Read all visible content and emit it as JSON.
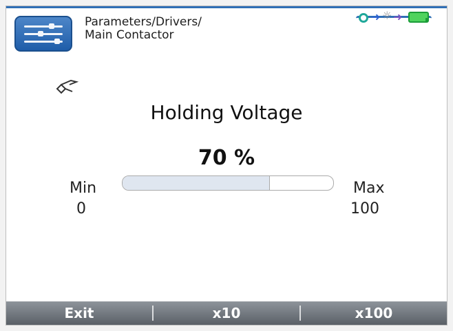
{
  "header": {
    "breadcrumb_line1": "Parameters/Drivers/",
    "breadcrumb_line2": "Main Contactor",
    "icon": "settings-sliders-icon"
  },
  "status": {
    "icons": [
      "connection-ring-icon",
      "arrow-right-icon",
      "bulb-icon",
      "arrow-right-icon",
      "battery-icon"
    ],
    "colors": {
      "ring": "#20a89a",
      "arrow1": "#2f63d1",
      "arrow2": "#7a55c2",
      "battery": "#4fd35d"
    }
  },
  "main": {
    "tool_icon": "tool-icon",
    "title": "Holding Voltage",
    "value_text": "70 %",
    "value": 70,
    "min_label": "Min",
    "min_value": "0",
    "max_label": "Max",
    "max_value": "100"
  },
  "footer": {
    "buttons": [
      {
        "label": "Exit"
      },
      {
        "label": "x10"
      },
      {
        "label": "x100"
      }
    ]
  },
  "colors": {
    "accent": "#2f6fb5",
    "footer": "#6d737a"
  }
}
